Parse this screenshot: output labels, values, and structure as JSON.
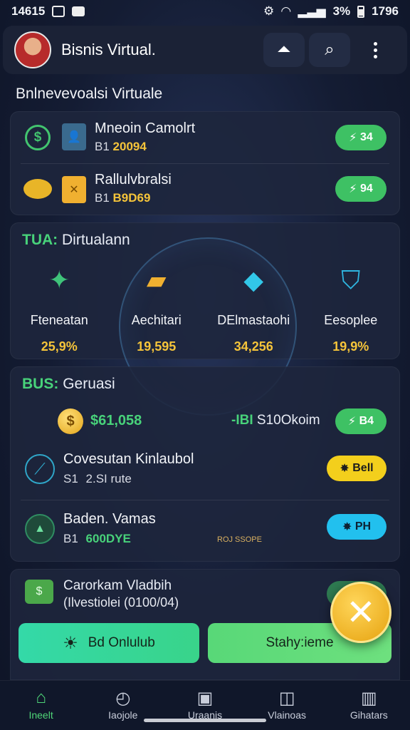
{
  "status_bar": {
    "time": "14615",
    "battery": "3%",
    "clock": "1796"
  },
  "app_bar": {
    "title": "Bisnis Virtual."
  },
  "section1": {
    "title": "Bnlnevevoalsi Virtuale",
    "rows": [
      {
        "name": "Mneoin Camolrt",
        "prefix": "B1",
        "amount": "20094",
        "badge": "34"
      },
      {
        "name": "Rallulvbralsi",
        "prefix": "B1",
        "amount": "B9D69",
        "badge": "94"
      }
    ]
  },
  "section2": {
    "tag": "TUA:",
    "title": "Dirtualann",
    "items": [
      {
        "icon": "network-icon",
        "label": "Fteneatan",
        "value": "25,9%"
      },
      {
        "icon": "ticket-icon",
        "label": "Aechitari",
        "value": "19,595"
      },
      {
        "icon": "blocks-icon",
        "label": "DElmastaohi",
        "value": "34,256"
      },
      {
        "icon": "shield-icon",
        "label": "Eesoplee",
        "value": "19,9%"
      }
    ]
  },
  "section3": {
    "tag": "BUS:",
    "title": "Geruasi",
    "balance": {
      "amount": "$61,058",
      "prefix": "-IBI",
      "label": "S10Okoim",
      "badge": "B4"
    },
    "rows": [
      {
        "name": "Covesutan Kinlaubol",
        "prefix": "S1",
        "amount": "2.SI",
        "suffix": "rute",
        "badge": "Bell"
      },
      {
        "name": "Baden. Vamas",
        "prefix": "B1",
        "amount": "600DYE",
        "note": "ROJ SSOPE",
        "badge": "PH"
      }
    ]
  },
  "section4": {
    "name": "Carorkam Vladbih",
    "detail": "(Ilvestiolei (0100/04)",
    "button_left": "Bd Onlulub",
    "button_right": "Stahy:ieme"
  },
  "bottom_nav": [
    {
      "icon": "home-icon",
      "label": "Ineelt"
    },
    {
      "icon": "gauge-icon",
      "label": "Iaojole"
    },
    {
      "icon": "card-icon",
      "label": "Uraanis"
    },
    {
      "icon": "stats-icon",
      "label": "Vlainoas"
    },
    {
      "icon": "chart-icon",
      "label": "Gihatars"
    }
  ],
  "colors": {
    "accent_green": "#3ec164",
    "accent_yellow": "#f3cf1c",
    "accent_cyan": "#22c0ee",
    "gold": "#f5c43a"
  }
}
